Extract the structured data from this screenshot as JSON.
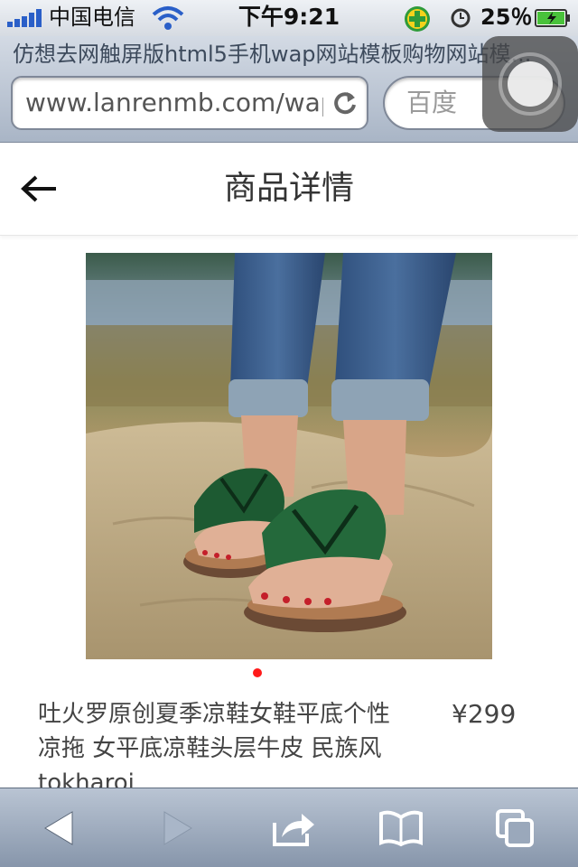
{
  "status_bar": {
    "carrier": "中国电信",
    "time": "下午9:21",
    "battery_percent": "25％",
    "icons": [
      "signal-icon",
      "wifi-icon",
      "plus-icon",
      "alarm-icon",
      "battery-icon"
    ]
  },
  "browser": {
    "page_title": "仿想去网触屏版html5手机wap网站模板购物网站模...",
    "url": "www.lanrenmb.com/wap",
    "search_placeholder": "百度"
  },
  "header": {
    "title": "商品详情",
    "back_icon": "arrow-left-icon"
  },
  "product": {
    "name": "吐火罗原创夏季凉鞋女鞋平底个性凉拖 女平底凉鞋头层牛皮 民族风 tokharoi",
    "price": "¥299",
    "image_icon": "product-photo-sandals",
    "carousel_active_color": "#ff1a1a"
  },
  "toolbar": {
    "icons": [
      "back-icon",
      "forward-icon",
      "share-icon",
      "bookmarks-icon",
      "tabs-icon"
    ]
  },
  "colors": {
    "accent": "#ff1a1a",
    "text": "#444444",
    "chrome_top": "#d3dae4",
    "chrome_bottom": "#a9b5c6"
  }
}
